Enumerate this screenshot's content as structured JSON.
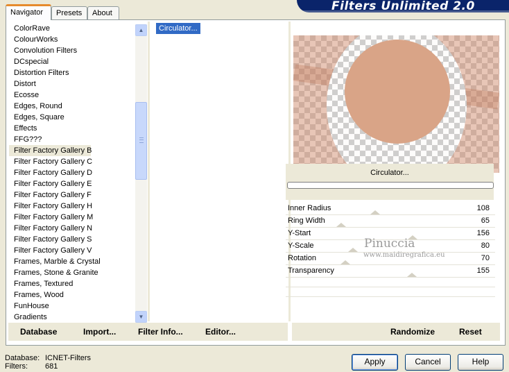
{
  "tabs": [
    "Navigator",
    "Presets",
    "About"
  ],
  "banner_title": "Filters Unlimited 2.0",
  "categories": [
    "ColorRave",
    "ColourWorks",
    "Convolution Filters",
    "DCspecial",
    "Distortion Filters",
    "Distort",
    "Ecosse",
    "Edges, Round",
    "Edges, Square",
    "Effects",
    "FFG???",
    "Filter Factory Gallery B",
    "Filter Factory Gallery C",
    "Filter Factory Gallery D",
    "Filter Factory Gallery E",
    "Filter Factory Gallery F",
    "Filter Factory Gallery H",
    "Filter Factory Gallery M",
    "Filter Factory Gallery N",
    "Filter Factory Gallery S",
    "Filter Factory Gallery V",
    "Frames, Marble & Crystal",
    "Frames, Stone & Granite",
    "Frames, Textured",
    "Frames, Wood",
    "FunHouse",
    "Gradients"
  ],
  "selected_category": "Filter Factory Gallery B",
  "filters": [
    "Circulator..."
  ],
  "selected_filter": "Circulator...",
  "filter_name": "Circulator...",
  "params": [
    {
      "label": "Inner Radius",
      "value": "108",
      "level": 108
    },
    {
      "label": "Ring Width",
      "value": "65",
      "level": 65
    },
    {
      "label": "Y-Start",
      "value": "156",
      "level": 156
    },
    {
      "label": "Y-Scale",
      "value": "80",
      "level": 80
    },
    {
      "label": "Rotation",
      "value": "70",
      "level": 70
    },
    {
      "label": "Transparency",
      "value": "155",
      "level": 155
    }
  ],
  "param_max": 255,
  "watermark": {
    "line1": "Pinuccia",
    "line2": "www.maidiregrafica.eu"
  },
  "bottom_left_buttons": {
    "database": "Database",
    "import": "Import...",
    "filter_info": "Filter Info...",
    "editor": "Editor..."
  },
  "bottom_right_buttons": {
    "randomize": "Randomize",
    "reset": "Reset"
  },
  "status": {
    "database_label": "Database:",
    "database_value": "ICNET-Filters",
    "filters_label": "Filters:",
    "filters_value": "681"
  },
  "dialog_buttons": {
    "apply": "Apply",
    "cancel": "Cancel",
    "help": "Help"
  },
  "icons": {
    "scroll_up": "chevron-up-icon",
    "scroll_down": "chevron-down-icon"
  },
  "colors": {
    "banner": "#0A246A",
    "selection": "#316AC5",
    "tab_accent": "#E68B2C"
  }
}
